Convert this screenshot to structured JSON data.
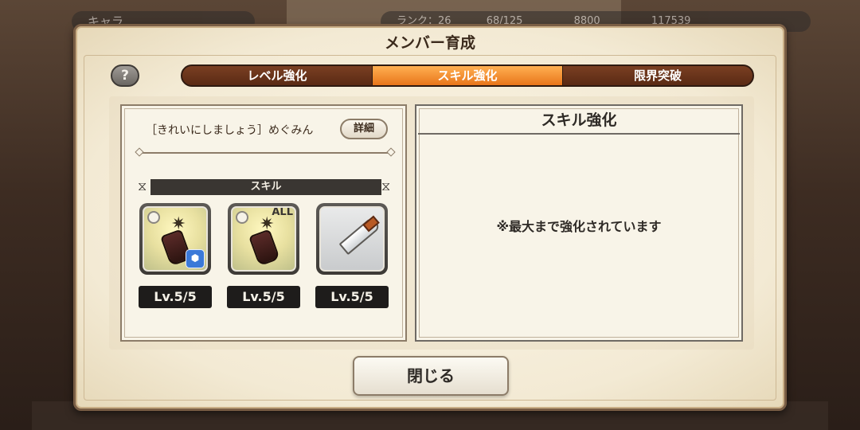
{
  "background": {
    "chara_label": "キャラ",
    "rank_label": "ランク：26",
    "stat_stamina": "68/125",
    "stat_jewels": "8800",
    "stat_mana": "117539"
  },
  "panel": {
    "title": "メンバー育成",
    "help_icon": "?",
    "tabs": [
      {
        "label": "レベル強化",
        "active": false
      },
      {
        "label": "スキル強化",
        "active": true
      },
      {
        "label": "限界突破",
        "active": false
      }
    ]
  },
  "character": {
    "name": "［きれいにしましょう］めぐみん",
    "detail_button": "詳細"
  },
  "skills": {
    "header": "スキル",
    "items": [
      {
        "icon": "bottle-burst-icon",
        "badge": "hex-badge-icon",
        "level": "Lv.5/5"
      },
      {
        "icon": "bottle-all-icon",
        "tag": "ALL",
        "level": "Lv.5/5"
      },
      {
        "icon": "spiked-sword-icon",
        "level": "Lv.5/5"
      }
    ]
  },
  "enhance": {
    "title": "スキル強化",
    "message": "※最大まで強化されています"
  },
  "nav": {
    "prev": "‹",
    "next": "›"
  },
  "close_button": "閉じる",
  "colors": {
    "active_tab": "#f08a28",
    "tab_bg": "#5a2a14",
    "arrow": "#e0308a",
    "panel_bg": "#f6efdc"
  }
}
